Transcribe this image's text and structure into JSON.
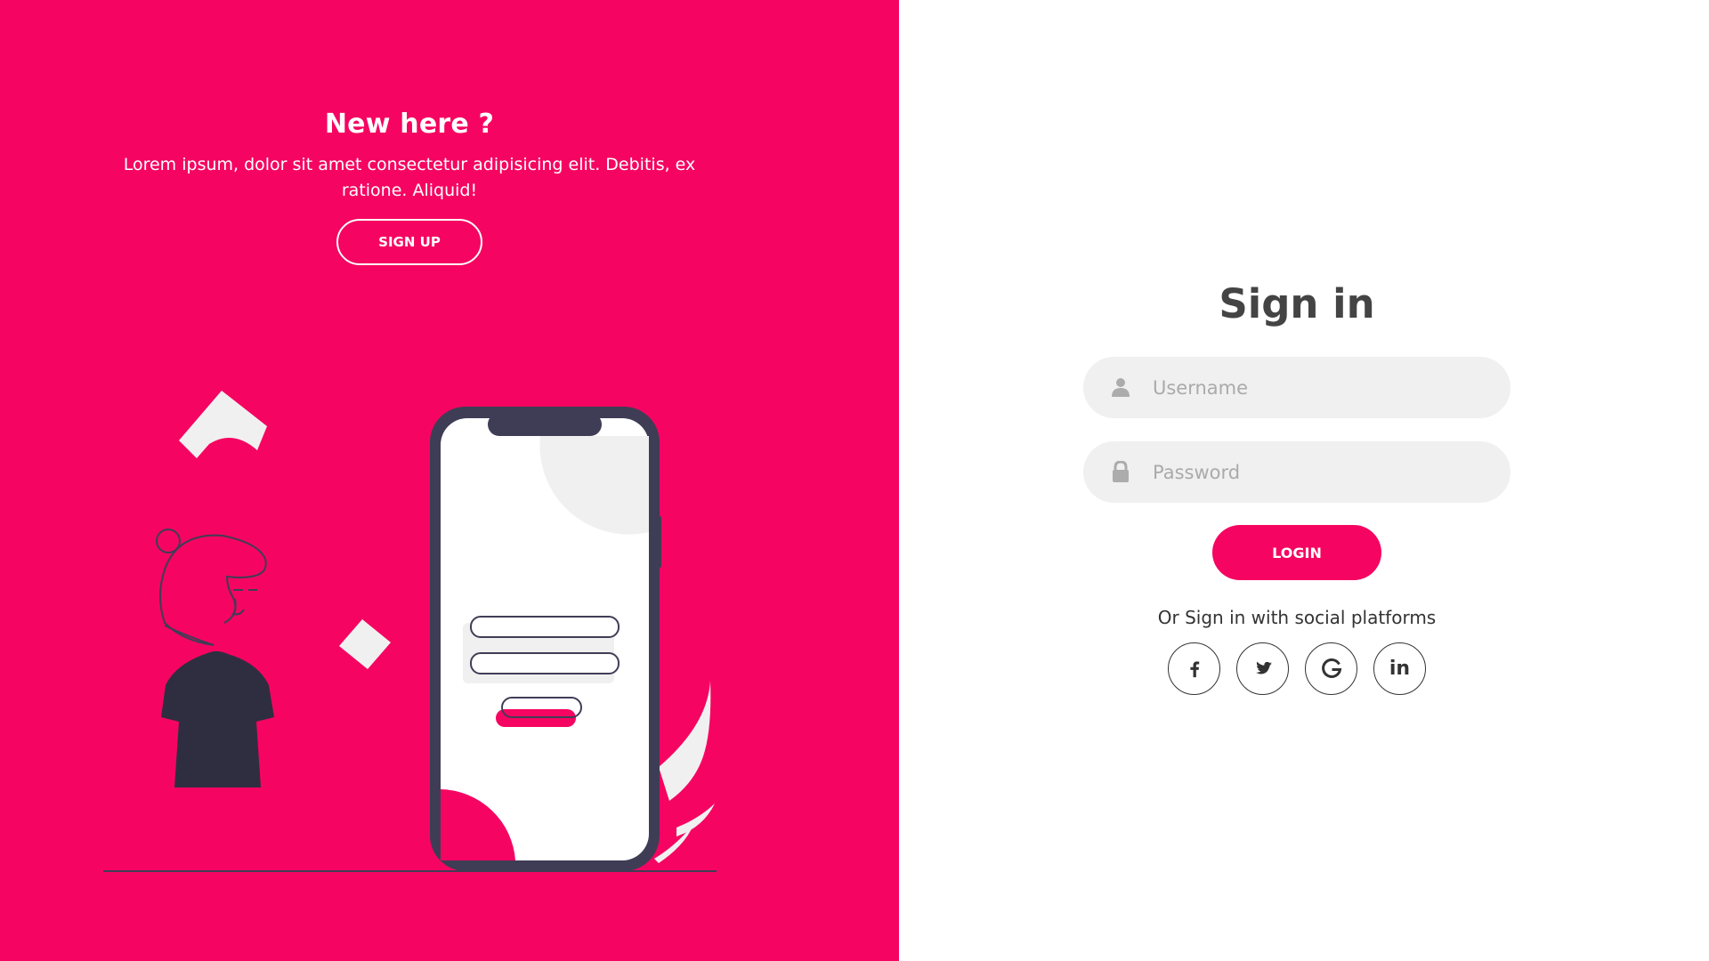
{
  "colors": {
    "accent": "#f50561",
    "dark": "#3f3d56",
    "light": "#f0f0f0",
    "text": "#444444"
  },
  "left": {
    "heading": "New here ?",
    "paragraph": "Lorem ipsum, dolor sit amet consectetur adipisicing elit. Debitis, ex ratione. Aliquid!",
    "signup_label": "SIGN UP"
  },
  "signin": {
    "title": "Sign in",
    "username_placeholder": "Username",
    "password_placeholder": "Password",
    "login_label": "LOGIN",
    "social_text": "Or Sign in with social platforms",
    "social": {
      "facebook_icon": "facebook-icon",
      "twitter_icon": "twitter-icon",
      "google_icon": "google-icon",
      "linkedin_label": "in"
    }
  }
}
